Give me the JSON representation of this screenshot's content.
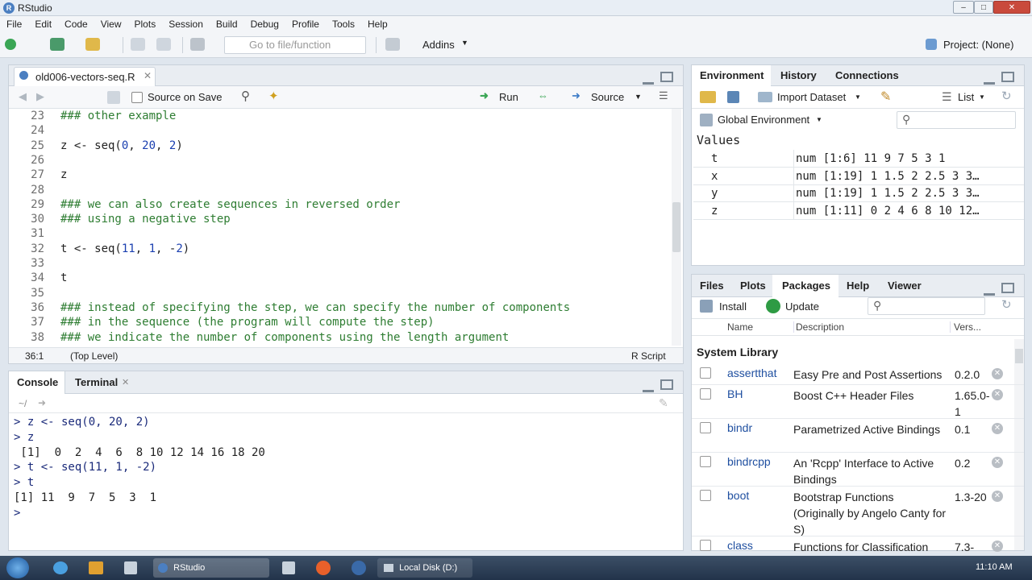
{
  "window": {
    "title": "RStudio"
  },
  "menu": [
    "File",
    "Edit",
    "Code",
    "View",
    "Plots",
    "Session",
    "Build",
    "Debug",
    "Profile",
    "Tools",
    "Help"
  ],
  "toolbar": {
    "goto_placeholder": "Go to file/function",
    "addins": "Addins",
    "project": "Project: (None)"
  },
  "editor": {
    "tab": "old006-vectors-seq.R",
    "source_on_save": "Source on Save",
    "run": "Run",
    "source": "Source",
    "lines": [
      {
        "n": "23",
        "t": "### other example",
        "c": true
      },
      {
        "n": "24",
        "t": "",
        "c": false
      },
      {
        "n": "25",
        "t": "z <- seq(0, 20, 2)",
        "c": false
      },
      {
        "n": "26",
        "t": "",
        "c": false
      },
      {
        "n": "27",
        "t": "z",
        "c": false
      },
      {
        "n": "28",
        "t": "",
        "c": false
      },
      {
        "n": "29",
        "t": "### we can also create sequences in reversed order",
        "c": true
      },
      {
        "n": "30",
        "t": "### using a negative step",
        "c": true
      },
      {
        "n": "31",
        "t": "",
        "c": false
      },
      {
        "n": "32",
        "t": "t <- seq(11, 1, -2)",
        "c": false
      },
      {
        "n": "33",
        "t": "",
        "c": false
      },
      {
        "n": "34",
        "t": "t",
        "c": false
      },
      {
        "n": "35",
        "t": "",
        "c": false
      },
      {
        "n": "36",
        "t": "### instead of specifying the step, we can specify the number of components",
        "c": true
      },
      {
        "n": "37",
        "t": "### in the sequence (the program will compute the step)",
        "c": true
      },
      {
        "n": "38",
        "t": "### we indicate the number of components using the length argument",
        "c": true
      }
    ],
    "status_pos": "36:1",
    "status_scope": "(Top Level)",
    "status_type": "R Script"
  },
  "console": {
    "tab_console": "Console",
    "tab_terminal": "Terminal",
    "path": "~/",
    "lines": [
      "> z <- seq(0, 20, 2)",
      "> z",
      " [1]  0  2  4  6  8 10 12 14 16 18 20",
      "> t <- seq(11, 1, -2)",
      "> t",
      "[1] 11  9  7  5  3  1",
      "> "
    ]
  },
  "environment": {
    "tabs": [
      "Environment",
      "History",
      "Connections"
    ],
    "import_dataset": "Import Dataset",
    "list": "List",
    "global_env": "Global Environment",
    "values_header": "Values",
    "rows": [
      {
        "name": "t",
        "value": "num [1:6] 11 9 7 5 3 1"
      },
      {
        "name": "x",
        "value": "num [1:19] 1 1.5 2 2.5 3 3…"
      },
      {
        "name": "y",
        "value": "num [1:19] 1 1.5 2 2.5 3 3…"
      },
      {
        "name": "z",
        "value": "num [1:11] 0 2 4 6 8 10 12…"
      }
    ]
  },
  "files": {
    "tabs": [
      "Files",
      "Plots",
      "Packages",
      "Help",
      "Viewer"
    ],
    "install": "Install",
    "update": "Update",
    "col_name": "Name",
    "col_desc": "Description",
    "col_ver": "Vers...",
    "section": "System Library",
    "packages": [
      {
        "name": "assertthat",
        "desc": "Easy Pre and Post Assertions",
        "ver": "0.2.0"
      },
      {
        "name": "BH",
        "desc": "Boost C++ Header Files",
        "ver": "1.65.0-1"
      },
      {
        "name": "bindr",
        "desc": "Parametrized Active Bindings",
        "ver": "0.1"
      },
      {
        "name": "bindrcpp",
        "desc": "An 'Rcpp' Interface to Active Bindings",
        "ver": "0.2"
      },
      {
        "name": "boot",
        "desc": "Bootstrap Functions (Originally by Angelo Canty for S)",
        "ver": "1.3-20"
      },
      {
        "name": "class",
        "desc": "Functions for Classification",
        "ver": "7.3-"
      }
    ]
  },
  "taskbar": {
    "rstudio": "RStudio",
    "localdisk": "Local Disk (D:)",
    "time": "11:10 AM"
  }
}
